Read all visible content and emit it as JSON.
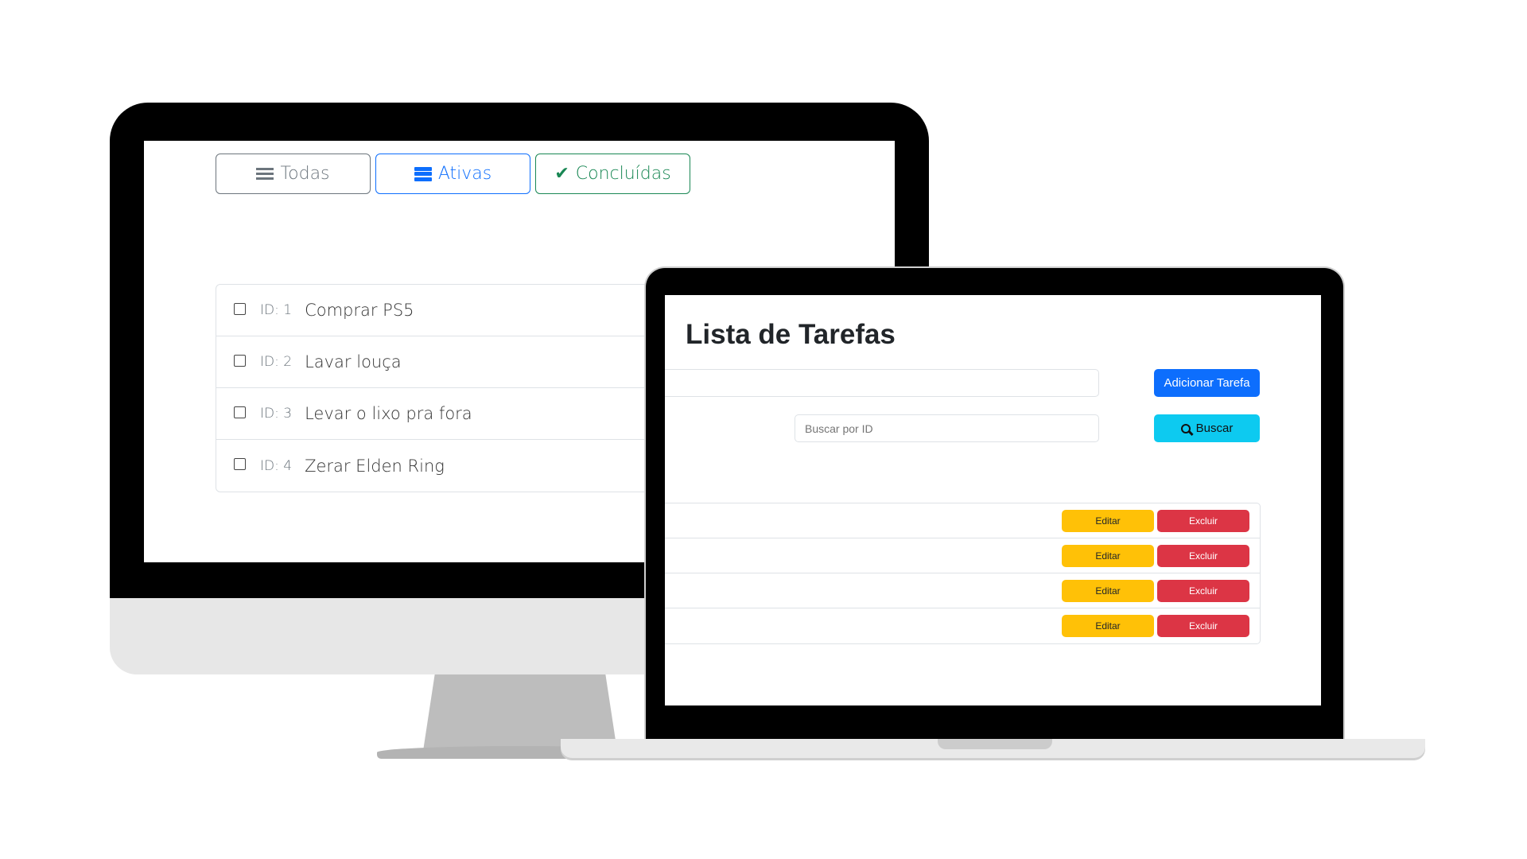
{
  "desktop": {
    "filters": [
      {
        "label": "Todas",
        "icon": "list-icon"
      },
      {
        "label": "Ativas",
        "icon": "stack-icon"
      },
      {
        "label": "Concluídas",
        "icon": "check-icon"
      }
    ],
    "tasks": [
      {
        "id": "ID: 1",
        "text": "Comprar PS5",
        "checked": false
      },
      {
        "id": "ID: 2",
        "text": "Lavar louça",
        "checked": false
      },
      {
        "id": "ID: 3",
        "text": "Levar o lixo pra fora",
        "checked": false
      },
      {
        "id": "ID: 4",
        "text": "Zerar Elden Ring",
        "checked": false
      }
    ]
  },
  "laptop": {
    "title": "Lista de Tarefas",
    "add_input": {
      "value": "",
      "placeholder": ""
    },
    "add_button": "Adicionar Tarefa",
    "search_input": {
      "value": "",
      "placeholder": "Buscar por ID"
    },
    "search_button": "Buscar",
    "rows": [
      {
        "edit": "Editar",
        "delete": "Excluir"
      },
      {
        "edit": "Editar",
        "delete": "Excluir"
      },
      {
        "edit": "Editar",
        "delete": "Excluir"
      },
      {
        "edit": "Editar",
        "delete": "Excluir"
      }
    ]
  },
  "colors": {
    "primary": "#0d6efd",
    "info": "#0dcaf0",
    "warning": "#ffc107",
    "danger": "#dc3545",
    "success": "#198754",
    "secondary": "#6c757d"
  }
}
